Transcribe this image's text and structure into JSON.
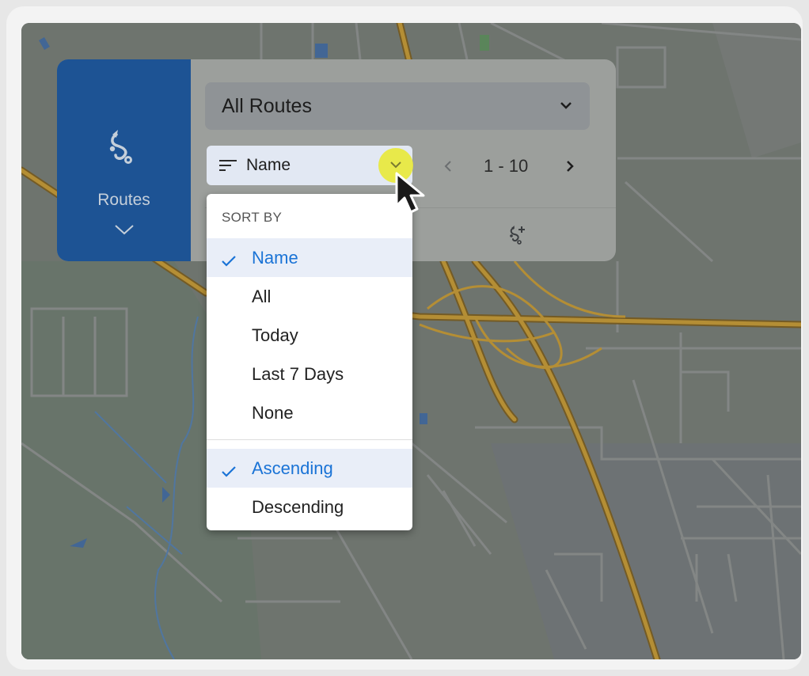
{
  "sidebar": {
    "label": "Routes",
    "icon": "route-icon",
    "collapse_icon": "chevron-down-icon",
    "color": "#1d5394"
  },
  "route_filter": {
    "value": "All Routes",
    "icon": "chevron-down-icon"
  },
  "sort": {
    "current": "Name",
    "icon": "sort-lines-icon",
    "dropdown": {
      "header": "SORT BY",
      "fields": [
        {
          "label": "Name",
          "selected": true
        },
        {
          "label": "All",
          "selected": false
        },
        {
          "label": "Today",
          "selected": false
        },
        {
          "label": "Last 7 Days",
          "selected": false
        },
        {
          "label": "None",
          "selected": false
        }
      ],
      "orders": [
        {
          "label": "Ascending",
          "selected": true
        },
        {
          "label": "Descending",
          "selected": false
        }
      ]
    }
  },
  "pagination": {
    "range": "1 - 10",
    "prev_icon": "chevron-left-icon",
    "next_icon": "chevron-right-icon"
  },
  "toolbar": {
    "add_route_icon": "route-add-icon"
  },
  "colors": {
    "accent": "#1a73d6",
    "selected_bg": "#e9eef8",
    "highway": "#c99a2e",
    "cursor_halo": "#e8e83c"
  }
}
